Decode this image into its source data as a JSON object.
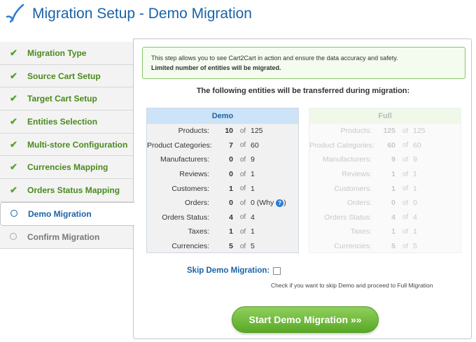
{
  "header": {
    "title": "Migration Setup - Demo Migration"
  },
  "sidebar": {
    "steps": [
      {
        "label": "Migration Type",
        "state": "done"
      },
      {
        "label": "Source Cart Setup",
        "state": "done"
      },
      {
        "label": "Target Cart Setup",
        "state": "done"
      },
      {
        "label": "Entities Selection",
        "state": "done"
      },
      {
        "label": "Multi-store Configuration",
        "state": "done"
      },
      {
        "label": "Currencies Mapping",
        "state": "done"
      },
      {
        "label": "Orders Status Mapping",
        "state": "done"
      },
      {
        "label": "Demo Migration",
        "state": "active"
      },
      {
        "label": "Confirm Migration",
        "state": "pending"
      }
    ]
  },
  "notice": {
    "line1": "This step allows you to see Cart2Cart in action and ensure the data accuracy and safety.",
    "line2": "Limited number of entities will be migrated."
  },
  "subtitle": "The following entities will be transferred during migration:",
  "of_label": "of",
  "demo_table": {
    "title": "Demo",
    "rows": [
      {
        "label": "Products:",
        "count": "10",
        "total": "125"
      },
      {
        "label": "Product Categories:",
        "count": "7",
        "total": "60"
      },
      {
        "label": "Manufacturers:",
        "count": "0",
        "total": "9"
      },
      {
        "label": "Reviews:",
        "count": "0",
        "total": "1"
      },
      {
        "label": "Customers:",
        "count": "1",
        "total": "1"
      },
      {
        "label": "Orders:",
        "count": "0",
        "total": "0 (Why"
      },
      {
        "label": "Orders Status:",
        "count": "4",
        "total": "4"
      },
      {
        "label": "Taxes:",
        "count": "1",
        "total": "1"
      },
      {
        "label": "Currencies:",
        "count": "5",
        "total": "5"
      }
    ]
  },
  "full_table": {
    "title": "Full",
    "rows": [
      {
        "label": "Products:",
        "count": "125",
        "total": "125"
      },
      {
        "label": "Product Categories:",
        "count": "60",
        "total": "60"
      },
      {
        "label": "Manufacturers:",
        "count": "9",
        "total": "9"
      },
      {
        "label": "Reviews:",
        "count": "1",
        "total": "1"
      },
      {
        "label": "Customers:",
        "count": "1",
        "total": "1"
      },
      {
        "label": "Orders:",
        "count": "0",
        "total": "0"
      },
      {
        "label": "Orders Status:",
        "count": "4",
        "total": "4"
      },
      {
        "label": "Taxes:",
        "count": "1",
        "total": "1"
      },
      {
        "label": "Currencies:",
        "count": "5",
        "total": "5"
      }
    ]
  },
  "skip": {
    "label": "Skip Demo Migration:",
    "help": "Check if you want to skip Demo and proceed to Full Migration"
  },
  "start_button": "Start Demo Migration »»",
  "colors": {
    "brand_blue": "#1a63a8",
    "accent_green": "#55a229"
  }
}
